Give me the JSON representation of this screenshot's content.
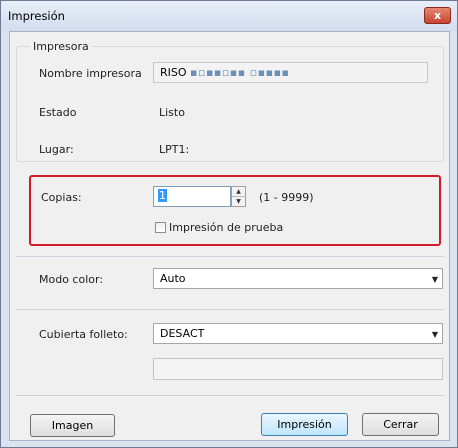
{
  "window": {
    "title": "Impresión",
    "close_symbol": "x"
  },
  "printer": {
    "group_label": "Impresora",
    "name_label": "Nombre impresora",
    "name_value_prefix": "RISO",
    "name_value_blurred": "▪▫▪▪▫▪▪ ▫▪▪▪▪",
    "status_label": "Estado",
    "status_value": "Listo",
    "location_label": "Lugar:",
    "location_value": "LPT1:"
  },
  "copies": {
    "label": "Copias:",
    "value": "1",
    "range": "(1 - 9999)",
    "proof_label": "Impresión de prueba",
    "proof_checked": false
  },
  "color_mode": {
    "label": "Modo color:",
    "value": "Auto"
  },
  "booklet_cover": {
    "label": "Cubierta folleto:",
    "value": "DESACT"
  },
  "buttons": {
    "image": "Imagen",
    "print": "Impresión",
    "close": "Cerrar"
  },
  "icons": {
    "spin_up": "▲",
    "spin_down": "▼",
    "dropdown": "▼"
  },
  "colors": {
    "highlight": "#d01c2a",
    "close_button": "#c74532"
  }
}
